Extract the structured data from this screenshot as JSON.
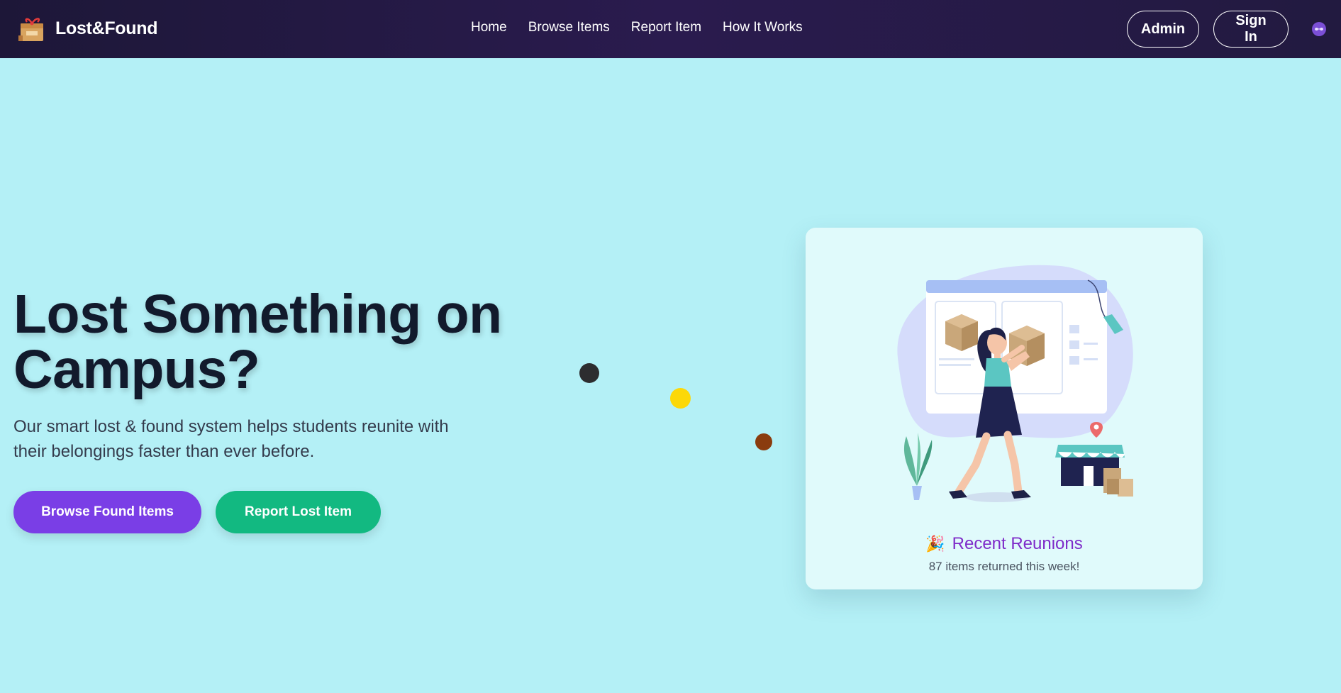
{
  "brand": {
    "name": "Lost&Found",
    "logo_icon": "gift-box-icon"
  },
  "nav": {
    "links": [
      {
        "label": "Home"
      },
      {
        "label": "Browse Items"
      },
      {
        "label": "Report Item"
      },
      {
        "label": "How It Works"
      }
    ],
    "admin_label": "Admin",
    "signin_label": "Sign In",
    "theme_icon": "theme-toggle-icon"
  },
  "hero": {
    "title": "Lost Something on Campus?",
    "subtitle": "Our smart lost & found system helps students reunite with their belongings faster than ever before.",
    "browse_label": "Browse Found Items",
    "report_label": "Report Lost Item"
  },
  "card": {
    "title": "Recent Reunions",
    "title_icon": "party-popper-icon",
    "subtitle": "87 items returned this week!"
  },
  "colors": {
    "background": "#b4f0f6",
    "navbar": "#231a44",
    "primary_purple": "#7a3ee6",
    "primary_green": "#12b981",
    "card_title": "#7e2bc9"
  }
}
